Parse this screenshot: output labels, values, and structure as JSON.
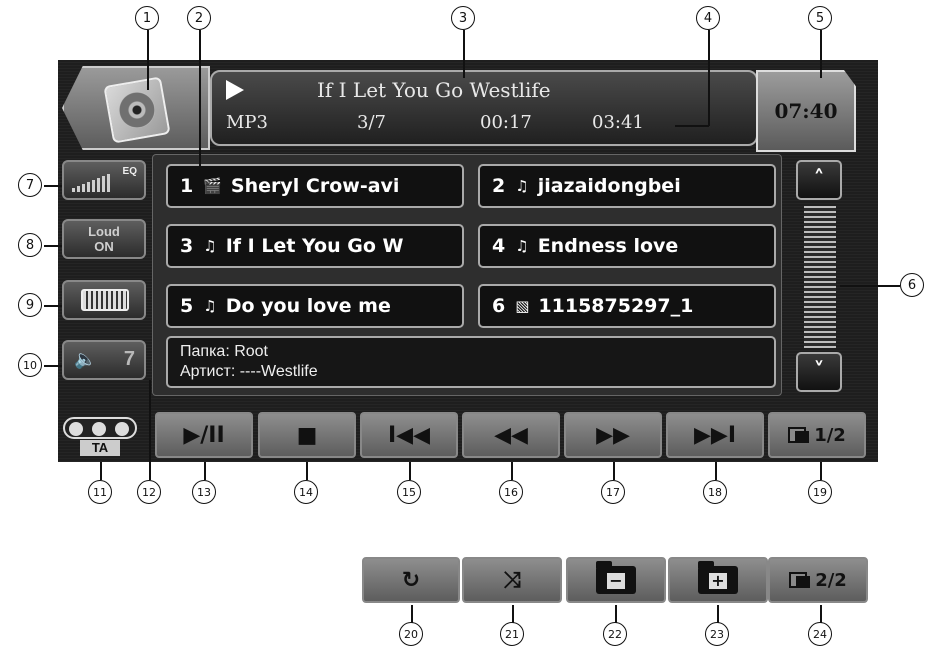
{
  "now_playing": {
    "title": "If I Let You Go Westlife",
    "format": "MP3",
    "track_position": "3/7",
    "elapsed": "00:17",
    "total": "03:41"
  },
  "clock": "07:40",
  "side_buttons": {
    "eq_label": "EQ",
    "loud_line1": "Loud",
    "loud_line2": "ON",
    "volume_level": "7",
    "ta_label": "TA"
  },
  "tracks": [
    {
      "num": "1",
      "icon": "video-file-icon",
      "glyph": "🎬",
      "name": "Sheryl Crow-avi"
    },
    {
      "num": "2",
      "icon": "music-note-icon",
      "glyph": "♫",
      "name": "jiazaidongbei"
    },
    {
      "num": "3",
      "icon": "music-note-icon",
      "glyph": "♫",
      "name": "If I Let You Go W"
    },
    {
      "num": "4",
      "icon": "music-note-icon",
      "glyph": "♫",
      "name": "Endness love"
    },
    {
      "num": "5",
      "icon": "music-note-icon",
      "glyph": "♫",
      "name": "Do you love me"
    },
    {
      "num": "6",
      "icon": "image-file-icon",
      "glyph": "▧",
      "name": "1115875297_1"
    }
  ],
  "details": {
    "folder": "Папка: Root",
    "artist": "Артист: ----Westlife"
  },
  "controls": {
    "play_pause": "▶/II",
    "stop": "■",
    "prev": "I◀◀",
    "rewind": "◀◀",
    "fast_forward": "▶▶",
    "next": "▶▶I",
    "page_1": "1/2"
  },
  "page2_controls": {
    "repeat": "↻",
    "shuffle": "⤨",
    "folder_down": "−",
    "folder_up": "+",
    "page_2": "2/2"
  },
  "scroll": {
    "up": "˄",
    "down": "˅"
  },
  "callouts": [
    "1",
    "2",
    "3",
    "4",
    "5",
    "6",
    "7",
    "8",
    "9",
    "10",
    "11",
    "12",
    "13",
    "14",
    "15",
    "16",
    "17",
    "18",
    "19",
    "20",
    "21",
    "22",
    "23",
    "24"
  ],
  "colors": {
    "panel": "#1e1e1e",
    "button": "#7a7a7a",
    "text_light": "#e8e8e8"
  }
}
